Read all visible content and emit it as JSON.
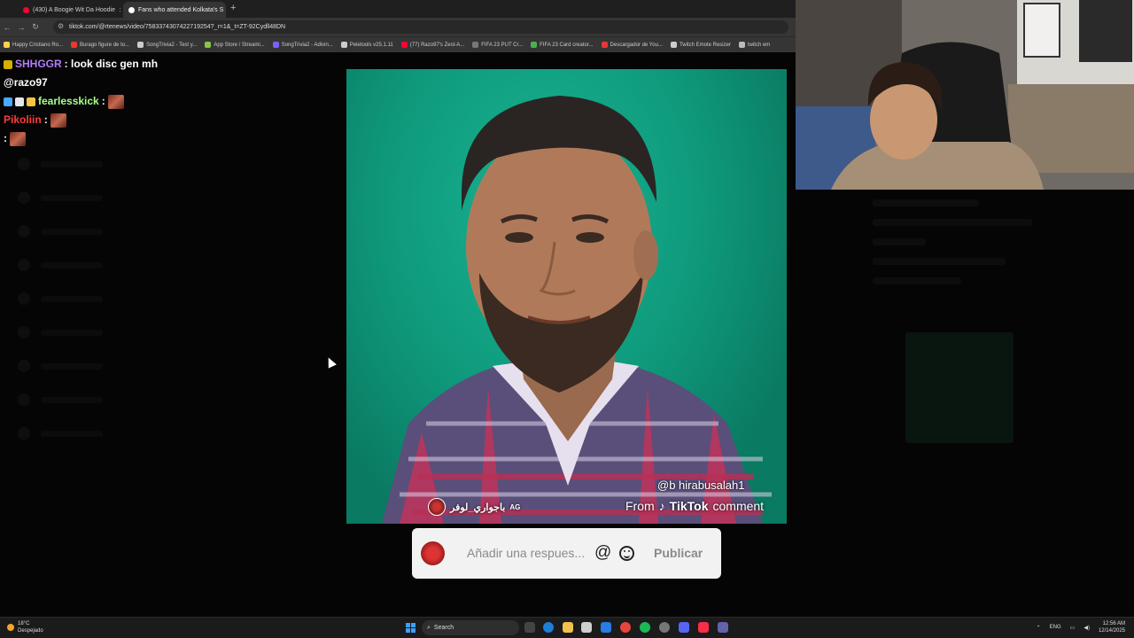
{
  "browser": {
    "tabs": [
      {
        "label": "(430) A Boogie Wit Da Hoodie",
        "color": "#ff0033",
        "active": false
      },
      {
        "label": "Fans who attended Kolkata's S",
        "color": "#ffffff",
        "active": true
      }
    ],
    "new_tab": "+",
    "url": "tiktok.com/@rtenews/video/7583374307422719254?_r=1&_t=ZT-92Cydll48DN",
    "bookmarks": [
      {
        "label": "Happy Cristiano Ro...",
        "color": "#ffd24a"
      },
      {
        "label": "Burago figure de to...",
        "color": "#e63b2e"
      },
      {
        "label": "SongTrivia2 - Test y...",
        "color": "#cccccc"
      },
      {
        "label": "App Store / Streami...",
        "color": "#8bc34a"
      },
      {
        "label": "SongTrivia2 - Adivin...",
        "color": "#7b61ff"
      },
      {
        "label": "Peletools v25.1.11",
        "color": "#cccccc"
      },
      {
        "label": "(77) Razo97's Zest-A...",
        "color": "#ff0033"
      },
      {
        "label": "FIFA 23 PUT Cr...",
        "color": "#777777"
      },
      {
        "label": "FIFA 23 Card creator...",
        "color": "#4caf50"
      },
      {
        "label": "Descargador de You...",
        "color": "#e53935"
      },
      {
        "label": "Twitch Emote Resizer",
        "color": "#cccccc"
      },
      {
        "label": "twitch em",
        "color": "#bbbbbb"
      }
    ]
  },
  "chat": {
    "messages": [
      {
        "user": "SHHGGR",
        "user_color": "#b57cff",
        "text": " : look disc gen mh",
        "badges": [
          "#d4b100"
        ]
      },
      {
        "user": "",
        "user_color": "#ffffff",
        "text": "@razo97",
        "badges": []
      },
      {
        "user": "fearlesskick",
        "user_color": "#a8ff8a",
        "text": " :",
        "badges": [
          "#4aa8ff",
          "#e6e6e6",
          "#f4c542"
        ],
        "emote": true
      },
      {
        "user": "Pikoliin",
        "user_color": "#ff3b3b",
        "text": " :",
        "badges": [],
        "emote": true
      },
      {
        "user": "",
        "user_color": "#ffffff",
        "text": ":",
        "badges": [],
        "emote": true
      }
    ]
  },
  "video": {
    "username": "باجواري_لوفر",
    "username_badge": "AG",
    "handle": "@b hirabusalah1",
    "from_text": "From",
    "brand": "TikTok",
    "comment_text": "comment"
  },
  "reply_box": {
    "placeholder": "Añadir una respues...",
    "at_symbol": "@",
    "publish_label": "Publicar"
  },
  "taskbar": {
    "temperature": "18°C",
    "weather": "Despejado",
    "search_label": "Search",
    "language": "ENG",
    "time": "12:56 AM",
    "date": "12/14/2025"
  }
}
